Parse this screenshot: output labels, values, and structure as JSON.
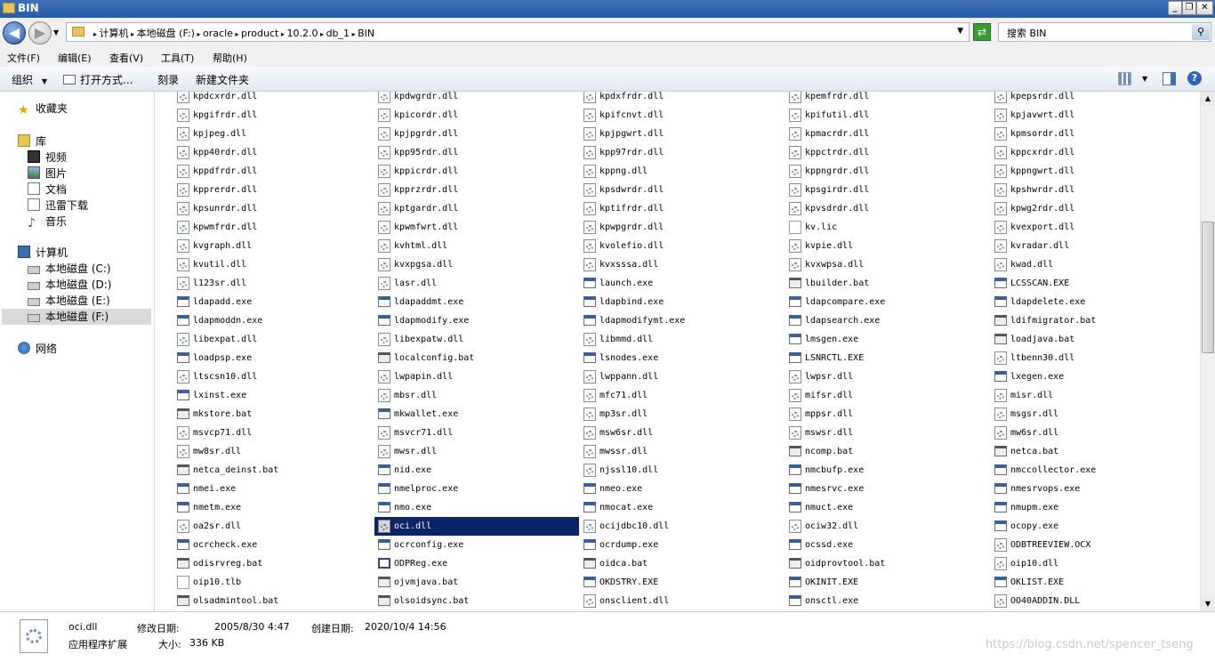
{
  "window": {
    "title": "BIN"
  },
  "address": {
    "crumbs": [
      "计算机",
      "本地磁盘 (F:)",
      "oracle",
      "product",
      "10.2.0",
      "db_1",
      "BIN"
    ]
  },
  "search": {
    "placeholder": "搜索 BIN"
  },
  "menu": [
    "文件(F)",
    "编辑(E)",
    "查看(V)",
    "工具(T)",
    "帮助(H)"
  ],
  "toolbar": {
    "organize": "组织",
    "open_with": "打开方式...",
    "burn": "刻录",
    "new_folder": "新建文件夹"
  },
  "nav": {
    "favorites": "收藏夹",
    "libraries": "库",
    "lib_items": [
      "视频",
      "图片",
      "文档",
      "迅雷下载",
      "音乐"
    ],
    "computer": "计算机",
    "drives": [
      "本地磁盘 (C:)",
      "本地磁盘 (D:)",
      "本地磁盘 (E:)",
      "本地磁盘 (F:)"
    ],
    "network": "网络"
  },
  "files": [
    [
      "kpdcxrdr.dll",
      "kpdwgrdr.dll",
      "kpdxfrdr.dll",
      "kpemfrdr.dll",
      "kpepsrdr.dll"
    ],
    [
      "kpgifrdr.dll",
      "kpicordr.dll",
      "kpifcnvt.dll",
      "kpifutil.dll",
      "kpjavwrt.dll"
    ],
    [
      "kpjpeg.dll",
      "kpjpgrdr.dll",
      "kpjpgwrt.dll",
      "kpmacrdr.dll",
      "kpmsordr.dll"
    ],
    [
      "kpp40rdr.dll",
      "kpp95rdr.dll",
      "kpp97rdr.dll",
      "kppctrdr.dll",
      "kppcxrdr.dll"
    ],
    [
      "kppdfrdr.dll",
      "kppicrdr.dll",
      "kppng.dll",
      "kppngrdr.dll",
      "kppngwrt.dll"
    ],
    [
      "kpprerdr.dll",
      "kpprzrdr.dll",
      "kpsdwrdr.dll",
      "kpsgirdr.dll",
      "kpshwrdr.dll"
    ],
    [
      "kpsunrdr.dll",
      "kptgardr.dll",
      "kptifrdr.dll",
      "kpvsdrdr.dll",
      "kpwg2rdr.dll"
    ],
    [
      "kpwmfrdr.dll",
      "kpwmfwrt.dll",
      "kpwpgrdr.dll",
      "kv.lic",
      "kvexport.dll"
    ],
    [
      "kvgraph.dll",
      "kvhtml.dll",
      "kvolefio.dll",
      "kvpie.dll",
      "kvradar.dll"
    ],
    [
      "kvutil.dll",
      "kvxpgsa.dll",
      "kvxsssa.dll",
      "kvxwpsa.dll",
      "kwad.dll"
    ],
    [
      "l123sr.dll",
      "lasr.dll",
      "launch.exe",
      "lbuilder.bat",
      "LCSSCAN.EXE"
    ],
    [
      "ldapadd.exe",
      "ldapaddmt.exe",
      "ldapbind.exe",
      "ldapcompare.exe",
      "ldapdelete.exe"
    ],
    [
      "ldapmoddn.exe",
      "ldapmodify.exe",
      "ldapmodifymt.exe",
      "ldapsearch.exe",
      "ldifmigrator.bat"
    ],
    [
      "libexpat.dll",
      "libexpatw.dll",
      "libmmd.dll",
      "lmsgen.exe",
      "loadjava.bat"
    ],
    [
      "loadpsp.exe",
      "localconfig.bat",
      "lsnodes.exe",
      "LSNRCTL.EXE",
      "ltbenn30.dll"
    ],
    [
      "ltscsn10.dll",
      "lwpapin.dll",
      "lwppann.dll",
      "lwpsr.dll",
      "lxegen.exe"
    ],
    [
      "lxinst.exe",
      "mbsr.dll",
      "mfc71.dll",
      "mifsr.dll",
      "misr.dll"
    ],
    [
      "mkstore.bat",
      "mkwallet.exe",
      "mp3sr.dll",
      "mppsr.dll",
      "msgsr.dll"
    ],
    [
      "msvcp71.dll",
      "msvcr71.dll",
      "msw6sr.dll",
      "mswsr.dll",
      "mw6sr.dll"
    ],
    [
      "mw8sr.dll",
      "mwsr.dll",
      "mwssr.dll",
      "ncomp.bat",
      "netca.bat"
    ],
    [
      "netca_deinst.bat",
      "nid.exe",
      "njssl10.dll",
      "nmcbufp.exe",
      "nmccollector.exe"
    ],
    [
      "nmei.exe",
      "nmelproc.exe",
      "nmeo.exe",
      "nmesrvc.exe",
      "nmesrvops.exe"
    ],
    [
      "nmetm.exe",
      "nmo.exe",
      "nmocat.exe",
      "nmuct.exe",
      "nmupm.exe"
    ],
    [
      "oa2sr.dll",
      "oci.dll",
      "ocijdbc10.dll",
      "ociw32.dll",
      "ocopy.exe"
    ],
    [
      "ocrcheck.exe",
      "ocrconfig.exe",
      "ocrdump.exe",
      "ocssd.exe",
      "ODBTREEVIEW.OCX"
    ],
    [
      "odisrvreg.bat",
      "ODPReg.exe",
      "oidca.bat",
      "oidprovtool.bat",
      "oip10.dll"
    ],
    [
      "oip10.tlb",
      "ojvmjava.bat",
      "OKDSTRY.EXE",
      "OKINIT.EXE",
      "OKLIST.EXE"
    ],
    [
      "olsadmintool.bat",
      "olsoidsync.bat",
      "onsclient.dll",
      "onsctl.exe",
      "OO40ADDIN.DLL"
    ]
  ],
  "selected_file": "oci.dll",
  "details": {
    "name": "oci.dll",
    "type": "应用程序扩展",
    "modified_label": "修改日期:",
    "modified": "2005/8/30 4:47",
    "size_label": "大小:",
    "size": "336 KB",
    "created_label": "创建日期:",
    "created": "2020/10/4 14:56"
  },
  "watermark": "https://blog.csdn.net/spencer_tseng"
}
